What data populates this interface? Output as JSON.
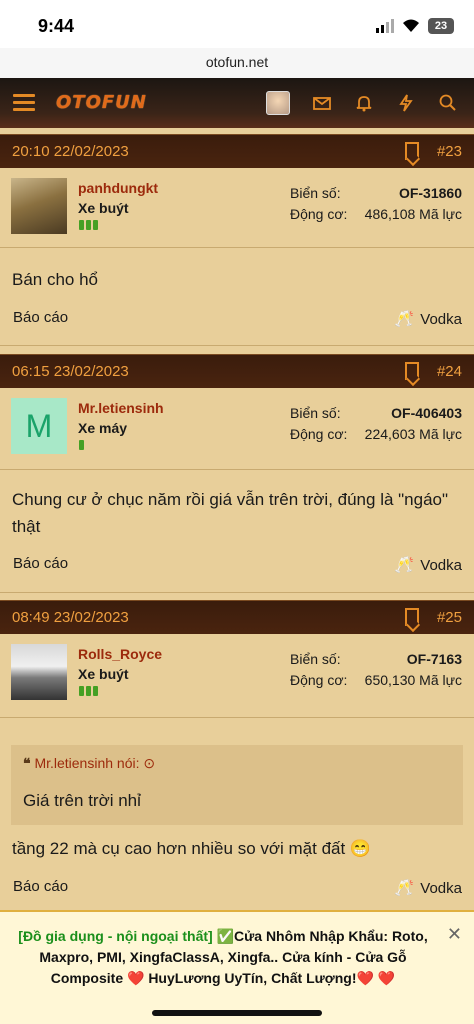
{
  "status_bar": {
    "time": "9:44",
    "battery": "23"
  },
  "browser": {
    "url": "otofun.net"
  },
  "nav": {
    "logo": "OTOFUN"
  },
  "posts": [
    {
      "date": "20:10 22/02/2023",
      "number": "#23",
      "username": "panhdungkt",
      "user_title": "Xe buýt",
      "plate_label": "Biển số:",
      "plate": "OF-31860",
      "engine_label": "Động cơ:",
      "engine": "486,108 Mã lực",
      "message": "Bán cho hổ",
      "report": "Báo cáo",
      "reaction": "Vodka"
    },
    {
      "date": "06:15 23/02/2023",
      "number": "#24",
      "username": "Mr.letiensinh",
      "avatar_letter": "M",
      "user_title": "Xe máy",
      "plate_label": "Biển số:",
      "plate": "OF-406403",
      "engine_label": "Động cơ:",
      "engine": "224,603 Mã lực",
      "message": "Chung cư ở chục năm rồi giá vẫn trên trời, đúng là \"ngáo\" thật",
      "report": "Báo cáo",
      "reaction": "Vodka"
    },
    {
      "date": "08:49 23/02/2023",
      "number": "#25",
      "username": "Rolls_Royce",
      "user_title": "Xe buýt",
      "plate_label": "Biển số:",
      "plate": "OF-7163",
      "engine_label": "Động cơ:",
      "engine": "650,130 Mã lực",
      "quote_author": "Mr.letiensinh nói:",
      "quote_text": "Giá trên trời nhỉ",
      "message": "tầng 22 mà cụ cao hơn nhiều so với mặt đất 😁",
      "report": "Báo cáo",
      "reaction": "Vodka"
    }
  ],
  "ad": {
    "category": "[Đồ gia dụng - nội ngoại thất]",
    "text": "✅Cửa Nhôm Nhập Khẩu: Roto, Maxpro, PMI, XingfaClassA, Xingfa.. Cửa kính - Cửa Gỗ Composite ❤️ HuyLương UyTín, Chất Lượng!❤️ ❤️"
  },
  "colors": {
    "accent": "#e48a25",
    "header_bg": "#3a1c0c",
    "page_bg": "#e8cf9a",
    "username": "#9c2a0c"
  }
}
